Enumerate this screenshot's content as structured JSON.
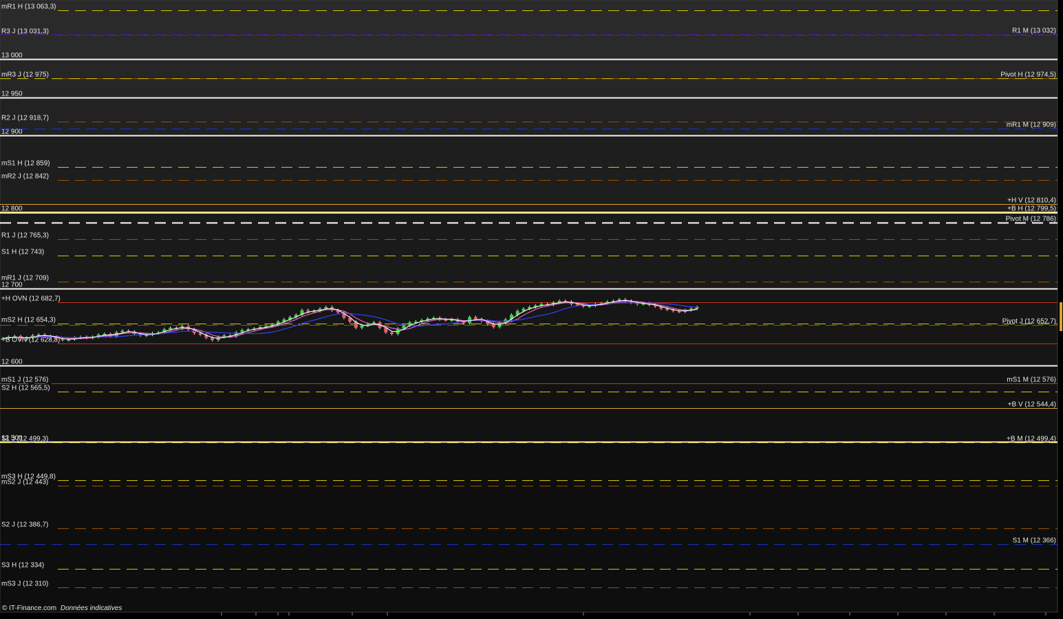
{
  "footer": {
    "copyright": "© IT-Finance.com",
    "note": "Données indicatives"
  },
  "chart_data": {
    "type": "line",
    "title": "",
    "xlabel": "",
    "ylabel": "",
    "ylim": [
      12300,
      13070
    ],
    "grid_prices": [
      13000,
      12950,
      12900,
      12800,
      12700,
      12600,
      12500
    ],
    "grid_labels": [
      "13 000",
      "12 950",
      "12 900",
      "12 800",
      "12 700",
      "12 600",
      "12 500"
    ],
    "levels_left": [
      {
        "label": "mR1 H (13 063,3)",
        "value": 13063.3,
        "color": "#d8c800"
      },
      {
        "label": "R3 J (13 031,3)",
        "value": 13031.3,
        "color": "#5020a0"
      },
      {
        "label": "mR3 J (12 975)",
        "value": 12975,
        "color": "#9a5200"
      },
      {
        "label": "R2 J (12 918,7)",
        "value": 12918.7,
        "color": "#9a5200"
      },
      {
        "label": "mS1 H (12 859)",
        "value": 12859,
        "color": "#d8c800"
      },
      {
        "label": "mR2 J (12 842)",
        "value": 12842,
        "color": "#9a5200"
      },
      {
        "label": "R1 J (12 765,3)",
        "value": 12765.3,
        "color": "#9a5200"
      },
      {
        "label": "S1 H (12 743)",
        "value": 12743,
        "color": "#d8c800"
      },
      {
        "label": "mR1 J (12 709)",
        "value": 12709,
        "color": "#9a5200"
      },
      {
        "label": "+H OVN (12 682,7)",
        "value": 12682.7,
        "color": "#c83020"
      },
      {
        "label": "mS2 H (12 654,3)",
        "value": 12654.3,
        "color": "#d8c800"
      },
      {
        "label": "+B OVN (12 628,8)",
        "value": 12628.8,
        "color": "#c83020"
      },
      {
        "label": "mS1 J (12 576)",
        "value": 12576,
        "color": "#9a5200"
      },
      {
        "label": "S2 H (12 565,5)",
        "value": 12565.5,
        "color": "#d8c800"
      },
      {
        "label": "S1 J (12 499,3)",
        "value": 12499.3,
        "color": "#9a5200"
      },
      {
        "label": "mS3 H (12 449,8)",
        "value": 12449.8,
        "color": "#d8c800"
      },
      {
        "label": "mS2 J (12 443)",
        "value": 12443,
        "color": "#9a5200"
      },
      {
        "label": "S2 J (12 386,7)",
        "value": 12386.7,
        "color": "#9a5200"
      },
      {
        "label": "S3 H (12 334)",
        "value": 12334,
        "color": "#d8c800"
      },
      {
        "label": "mS3 J (12 310)",
        "value": 12310,
        "color": "#9a5200"
      }
    ],
    "levels_right": [
      {
        "label": "R1 M (13 032)",
        "value": 13032,
        "color": "#5020a0"
      },
      {
        "label": "Pivot H (12 974,5)",
        "value": 12974.5,
        "color": "#d8c800"
      },
      {
        "label": "mR1 M (12 909)",
        "value": 12909,
        "color": "#2030c0"
      },
      {
        "label": "+H V (12 810,4)",
        "value": 12810.4,
        "color": "#e0a030"
      },
      {
        "label": "+B H (12 799,5)",
        "value": 12799.5,
        "color": "#f0e090"
      },
      {
        "label": "Pivot M (12 786)",
        "value": 12786,
        "color": "#ffffff"
      },
      {
        "label": "Pivot J (12 652,7)",
        "value": 12652.7,
        "color": "#9a5200"
      },
      {
        "label": "mS1 M (12 576)",
        "value": 12576,
        "color": "#9a5200"
      },
      {
        "label": "+B V (12 544,4)",
        "value": 12544.4,
        "color": "#e0a030"
      },
      {
        "label": "+B M (12 499,4)",
        "value": 12499.4,
        "color": "#d8c800"
      },
      {
        "label": "S1 M (12 366)",
        "value": 12366,
        "color": "#2030c0"
      }
    ],
    "series": [
      {
        "values": [
          12635,
          12637,
          12638,
          12634,
          12636,
          12639,
          12640,
          12638,
          12637,
          12635,
          12633,
          12634,
          12636,
          12637,
          12636,
          12637,
          12640,
          12641,
          12638,
          12643,
          12645,
          12644,
          12641,
          12639,
          12640,
          12642,
          12643,
          12647,
          12649,
          12648,
          12651,
          12647,
          12642,
          12640,
          12636,
          12633,
          12637,
          12639,
          12638,
          12643,
          12646,
          12647,
          12648,
          12650,
          12651,
          12653,
          12657,
          12660,
          12663,
          12666,
          12672,
          12670,
          12671,
          12674,
          12676,
          12672,
          12669,
          12662,
          12657,
          12649,
          12652,
          12654,
          12656,
          12649,
          12643,
          12641,
          12648,
          12652,
          12656,
          12657,
          12659,
          12661,
          12662,
          12660,
          12659,
          12660,
          12657,
          12655,
          12663,
          12660,
          12658,
          12654,
          12650,
          12656,
          12660,
          12666,
          12671,
          12674,
          12676,
          12678,
          12680,
          12679,
          12682,
          12684,
          12683,
          12680,
          12679,
          12677,
          12678,
          12680,
          12681,
          12683,
          12684,
          12686,
          12684,
          12682,
          12680,
          12681,
          12679,
          12677,
          12674,
          12673,
          12671,
          12670,
          12672,
          12674,
          12676
        ]
      }
    ]
  }
}
